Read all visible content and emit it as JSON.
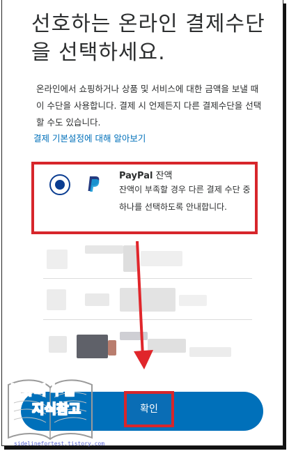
{
  "header": {
    "title": "선호하는 온라인 결제수단을 선택하세요."
  },
  "description": "온라인에서 쇼핑하거나 상품 및 서비스에 대한 금액을 보낼 때 이 수단을 사용합니다. 결제 시 언제든지 다른 결제수단을 선택할 수도 있습니다.",
  "preferences_link": "결제 기본설정에 대해 알아보기",
  "selected_option": {
    "brand": "PayPal",
    "label": "잔액",
    "description": "잔액이 부족할 경우 다른 결제 수단 중 하나를 선택하도록 안내합니다.",
    "selected": true,
    "icon": "paypal-logo-icon"
  },
  "confirm_button": {
    "label": "확인"
  },
  "watermark": {
    "line1": "블슈의 부업",
    "line2": "지식참고",
    "url": "sidelinefortest.tistory.com"
  },
  "colors": {
    "accent": "#0070ba",
    "radio": "#0b3d91",
    "highlight": "#d7262b",
    "text": "#2c2e2f"
  }
}
